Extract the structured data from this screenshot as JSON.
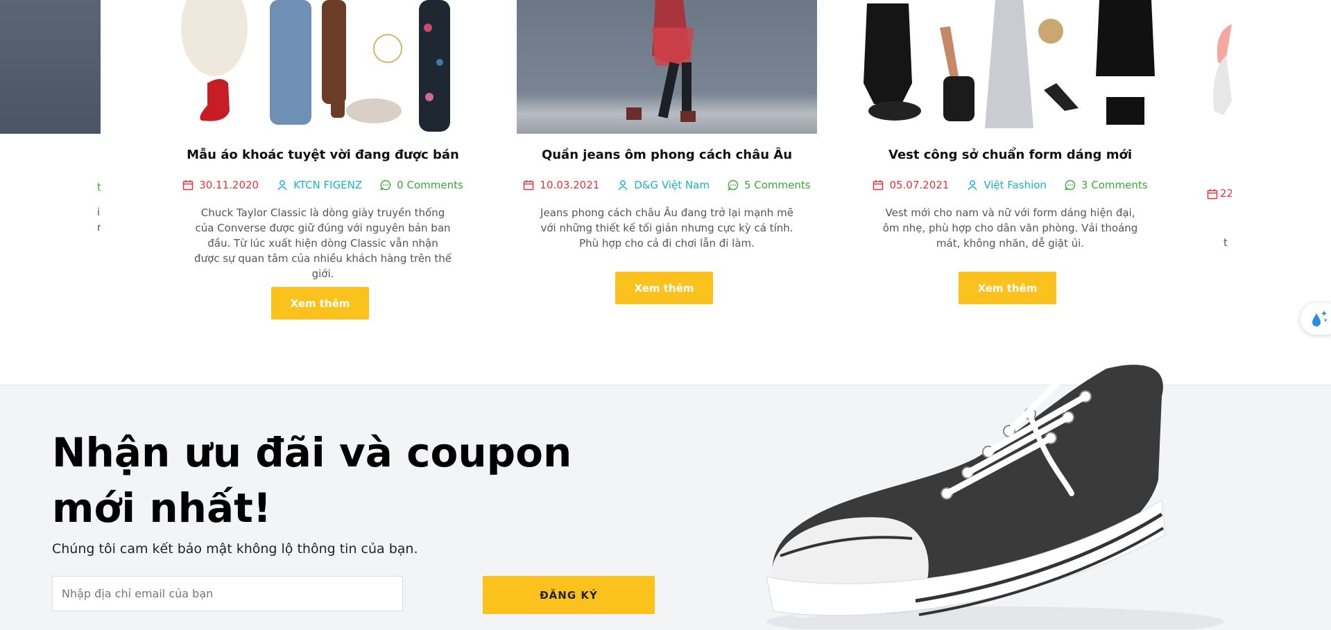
{
  "blog": {
    "posts": [
      {
        "title": "Mẫu áo khoác tuyệt vời đang được bán",
        "date": "30.11.2020",
        "author": "KTCN FIGENZ",
        "comments": "0 Comments",
        "excerpt": "Chuck Taylor Classic là dòng giày truyền thống của Converse được giữ đúng với nguyên bản ban đầu. Từ lúc xuất hiện dòng Classic vẫn nhận được sự quan tâm của nhiều khách hàng trên thế giới.",
        "button": "Xem thêm"
      },
      {
        "title": "Quần jeans ôm phong cách châu Âu",
        "date": "10.03.2021",
        "author": "D&G Việt Nam",
        "comments": "5 Comments",
        "excerpt": "Jeans phong cách châu Âu đang trở lại mạnh mẽ với những thiết kế tối giản nhưng cực kỳ cá tính. Phù hợp cho cả đi chơi lẫn đi làm.",
        "button": "Xem thêm"
      },
      {
        "title": "Vest công sở chuẩn form dáng mới",
        "date": "05.07.2021",
        "author": "Việt Fashion",
        "comments": "3 Comments",
        "excerpt": "Vest mới cho nam và nữ với form dáng hiện đại, ôm nhẹ, phù hợp cho dân văn phòng. Vải thoáng mát, không nhăn, dễ giặt ủi.",
        "button": "Xem thêm"
      }
    ],
    "edge_left": {
      "meta_fragment": "ts",
      "text_line1": "in",
      "text_line2": "n"
    },
    "edge_right": {
      "date_fragment": "22",
      "text_fragment": "t"
    }
  },
  "newsletter": {
    "title": "Nhận ưu đãi và coupon mới nhất!",
    "subtitle": "Chúng tôi cam kết bảo mật không lộ thông tin của bạn.",
    "email_placeholder": "Nhập địa chỉ email của bạn",
    "submit_label": "ĐĂNG KÝ"
  },
  "colors": {
    "accent": "#fbc21e",
    "date": "#e8313b",
    "author": "#16b5c9",
    "comments": "#3aa63a",
    "newsletter_bg": "#f3f4f6"
  },
  "icons": [
    "calendar-icon",
    "user-icon",
    "comment-icon",
    "water-drop-sparkle-icon"
  ]
}
